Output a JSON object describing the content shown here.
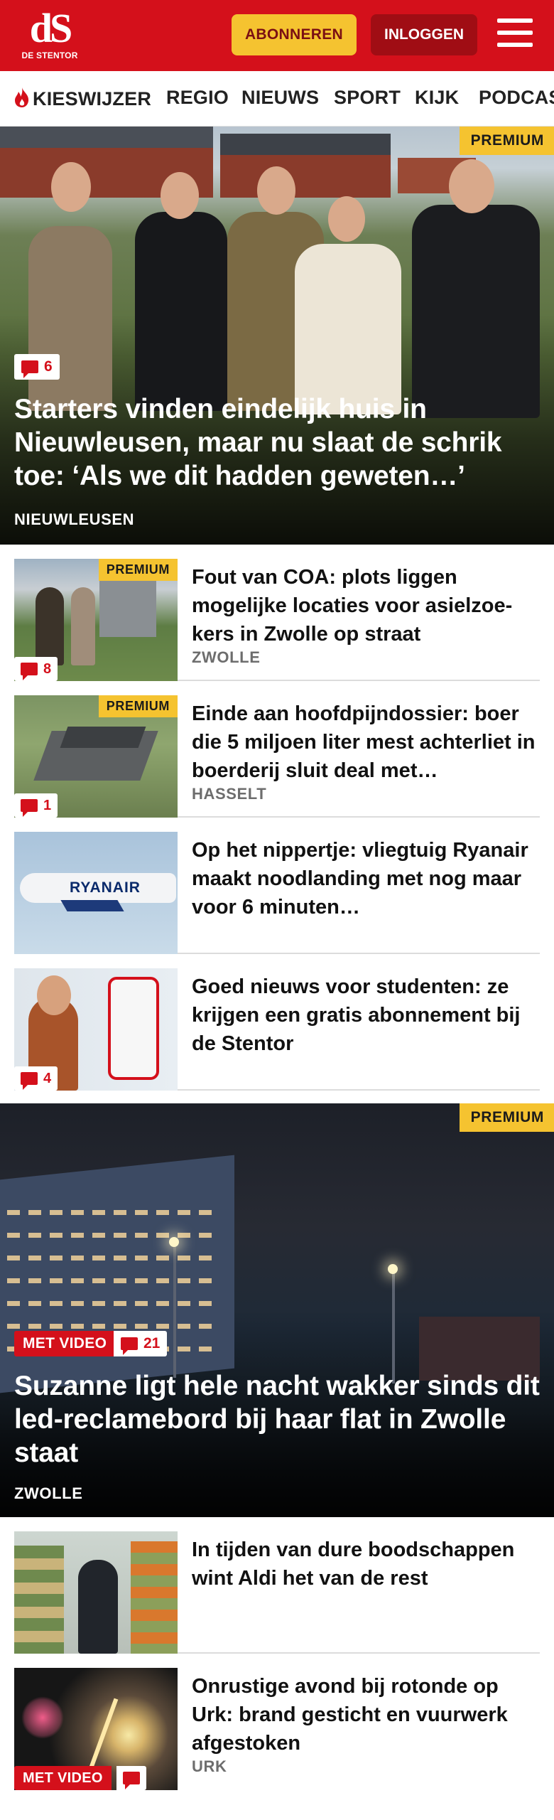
{
  "brand": {
    "logo_mark": "dS",
    "logo_text": "DE STENTOR"
  },
  "header": {
    "subscribe_label": "ABONNEREN",
    "login_label": "INLOGGEN"
  },
  "nav": {
    "items": [
      {
        "label": "KIESWIJZER",
        "icon": "flame-icon"
      },
      {
        "label": "REGIO"
      },
      {
        "label": "NIEUWS"
      },
      {
        "label": "SPORT"
      },
      {
        "label": "KIJK"
      },
      {
        "label": "PODCAS"
      }
    ]
  },
  "hero1": {
    "badge": "PREMIUM",
    "comments": "6",
    "title": "Starters vinden eindelijk huis in Nieuwleusen, maar nu slaat de schrik toe: ‘Als we dit hadden geweten…’",
    "location": "NIEUWLEUSEN"
  },
  "articles": [
    {
      "premium": "PREMIUM",
      "comments": "8",
      "title": "Fout van COA: plots liggen mogelijke locaties voor asielzoe- kers in Zwolle op straat",
      "location": "ZWOLLE"
    },
    {
      "premium": "PREMIUM",
      "comments": "1",
      "title": "Einde aan hoofdpijndossier: boer die 5 miljoen liter mest achterliet in boerderij sluit deal met…",
      "location": "HASSELT"
    },
    {
      "title": "Op het nippertje: vliegtuig Ryanair maakt noodlanding met nog maar voor 6 minuten…",
      "plane_text": "RYANAIR"
    },
    {
      "comments": "4",
      "title": "Goed nieuws voor studenten: ze krijgen een gratis abonnement bij de Stentor"
    }
  ],
  "hero2": {
    "badge": "PREMIUM",
    "video_label": "MET VIDEO",
    "comments": "21",
    "title": "Suzanne ligt hele nacht wakker sinds dit led-reclamebord bij haar flat in Zwolle staat",
    "location": "ZWOLLE"
  },
  "articles2": [
    {
      "title": "In tijden van dure boodschappen wint Aldi het van de rest"
    },
    {
      "video_label": "MET VIDEO",
      "title": "Onrustige avond bij rotonde op Urk: brand gesticht en vuurwerk afgestoken",
      "location": "URK"
    }
  ],
  "colors": {
    "brand_red": "#d4101b",
    "premium_yellow": "#f5c330",
    "login_dark_red": "#a00d14"
  }
}
